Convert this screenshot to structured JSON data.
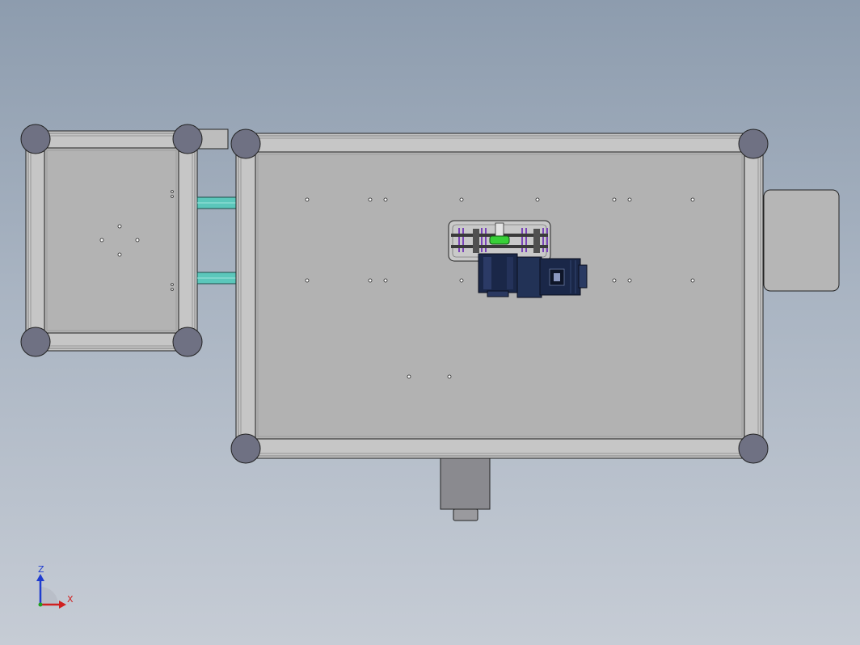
{
  "view": {
    "background_top": "#8d9cae",
    "background_bottom": "#c6ccd5",
    "model_fill": "#b1b1b1",
    "frame_fill": "#c3c3c3",
    "foot_fill": "#6f7183",
    "motor_fill": "#1a2748",
    "spring_accent": "#7a44b8",
    "coupling_accent": "#38d038",
    "rail_accent": "#4fc0b5"
  },
  "triad": {
    "z_label": "Z",
    "x_label": "X",
    "z_color": "#1f3ccf",
    "x_color": "#d02020"
  }
}
